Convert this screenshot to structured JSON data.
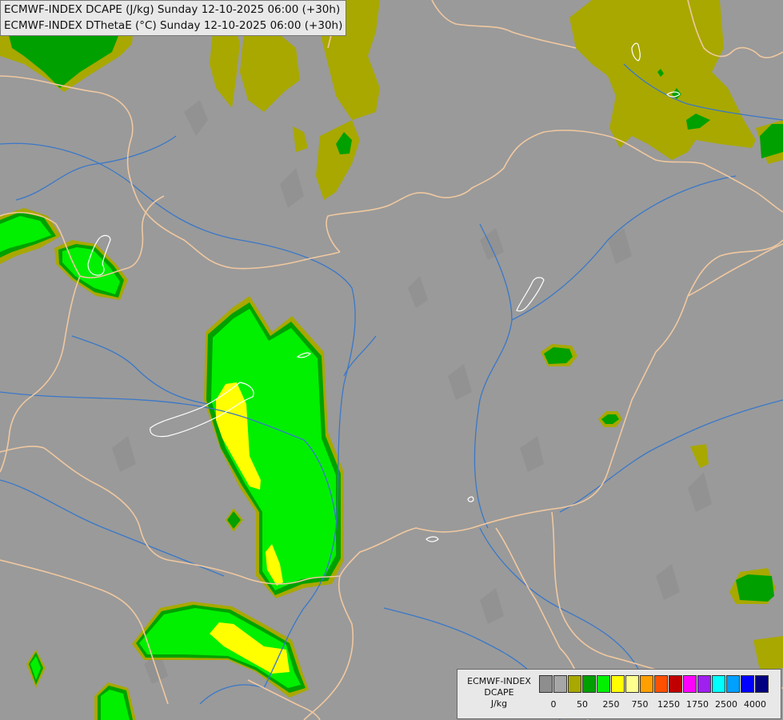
{
  "header": {
    "line1": "ECMWF-INDEX DCAPE (J/kg) Sunday 12-10-2025 06:00 (+30h)",
    "line2": "ECMWF-INDEX DThetaE (°C) Sunday 12-10-2025 06:00 (+30h)"
  },
  "legend": {
    "title_line1": "ECMWF-INDEX",
    "title_line2": "DCAPE",
    "title_line3": "J/kg",
    "colors": [
      "#8e8e8e",
      "#a6a6a6",
      "#a8a800",
      "#00a000",
      "#00f000",
      "#ffff00",
      "#ffff90",
      "#ffa000",
      "#ff5000",
      "#c00000",
      "#ff00ff",
      "#a020f0",
      "#00ffff",
      "#00a0ff",
      "#0000ff",
      "#000080"
    ],
    "ticks": [
      "0",
      "50",
      "250",
      "750",
      "1250",
      "1750",
      "2500",
      "4000"
    ]
  },
  "style": {
    "background": "#9a9a9a",
    "border_color": "#f0c8a0",
    "river_color": "#3a78c8",
    "lake_color": "#ffffff"
  }
}
